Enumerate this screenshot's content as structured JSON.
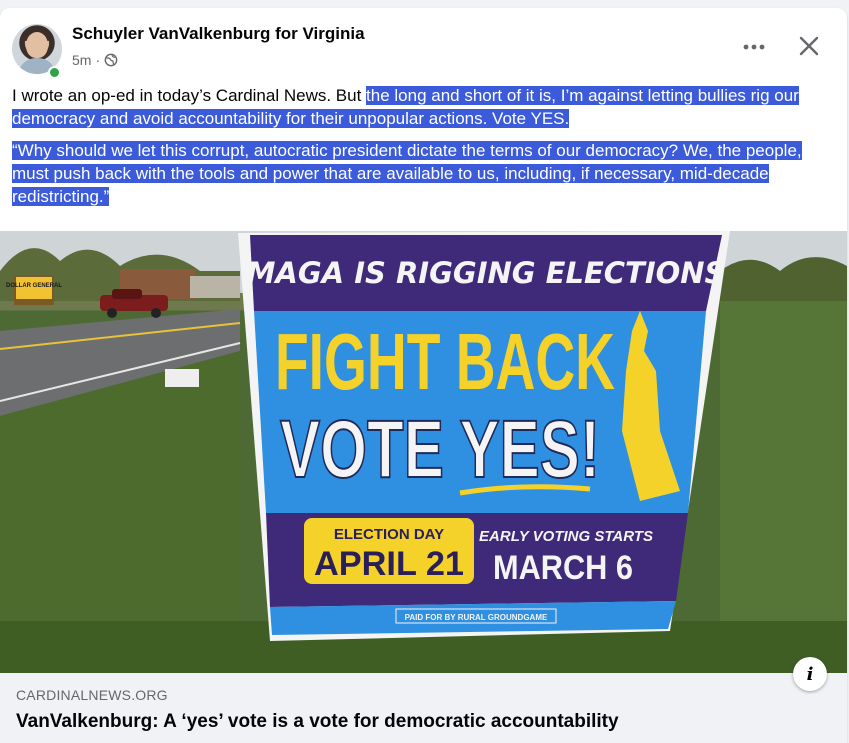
{
  "post": {
    "author": "Schuyler VanValkenburg for Virginia",
    "time": "5m",
    "privacy_icon": "globe-icon",
    "online_status_color": "#31a24c",
    "text_intro": "I wrote an op-ed in today’s Cardinal News. But ",
    "text_highlight_1": "the long and short of it is, I’m against letting bullies rig our democracy and avoid accountability for their unpopular actions. Vote YES.",
    "text_highlight_2": "“Why should we let this corrupt, autocratic president dictate the terms of our democracy? We, the people, must push back with the tools and power that are available to us, including, if necessary, mid-decade redistricting.”",
    "highlight_color": "#3b5bdb"
  },
  "actions": {
    "more_icon": "more-horizontal-icon",
    "more_label": "•••",
    "close_icon": "close-icon"
  },
  "photo": {
    "sign_headline": "MAGA IS RIGGING ELECTIONS",
    "sign_line1": "FIGHT BACK",
    "sign_line2": "VOTE YES!",
    "election_day_label": "ELECTION DAY",
    "election_day_date": "APRIL 21",
    "early_voting_label": "EARLY VOTING STARTS",
    "early_voting_date": "MARCH 6",
    "paid_for": "PAID FOR BY RURAL GROUNDGAME",
    "store_sign": "DOLLAR GENERAL",
    "colors": {
      "sign_purple": "#3e2a78",
      "sign_blue": "#2f8fe0",
      "sign_yellow": "#f4d22a",
      "sign_white": "#f4f4f4"
    }
  },
  "link": {
    "domain": "CARDINALNEWS.ORG",
    "title": "VanValkenburg: A ‘yes’ vote is a vote for democratic accountability",
    "info_label": "i"
  }
}
